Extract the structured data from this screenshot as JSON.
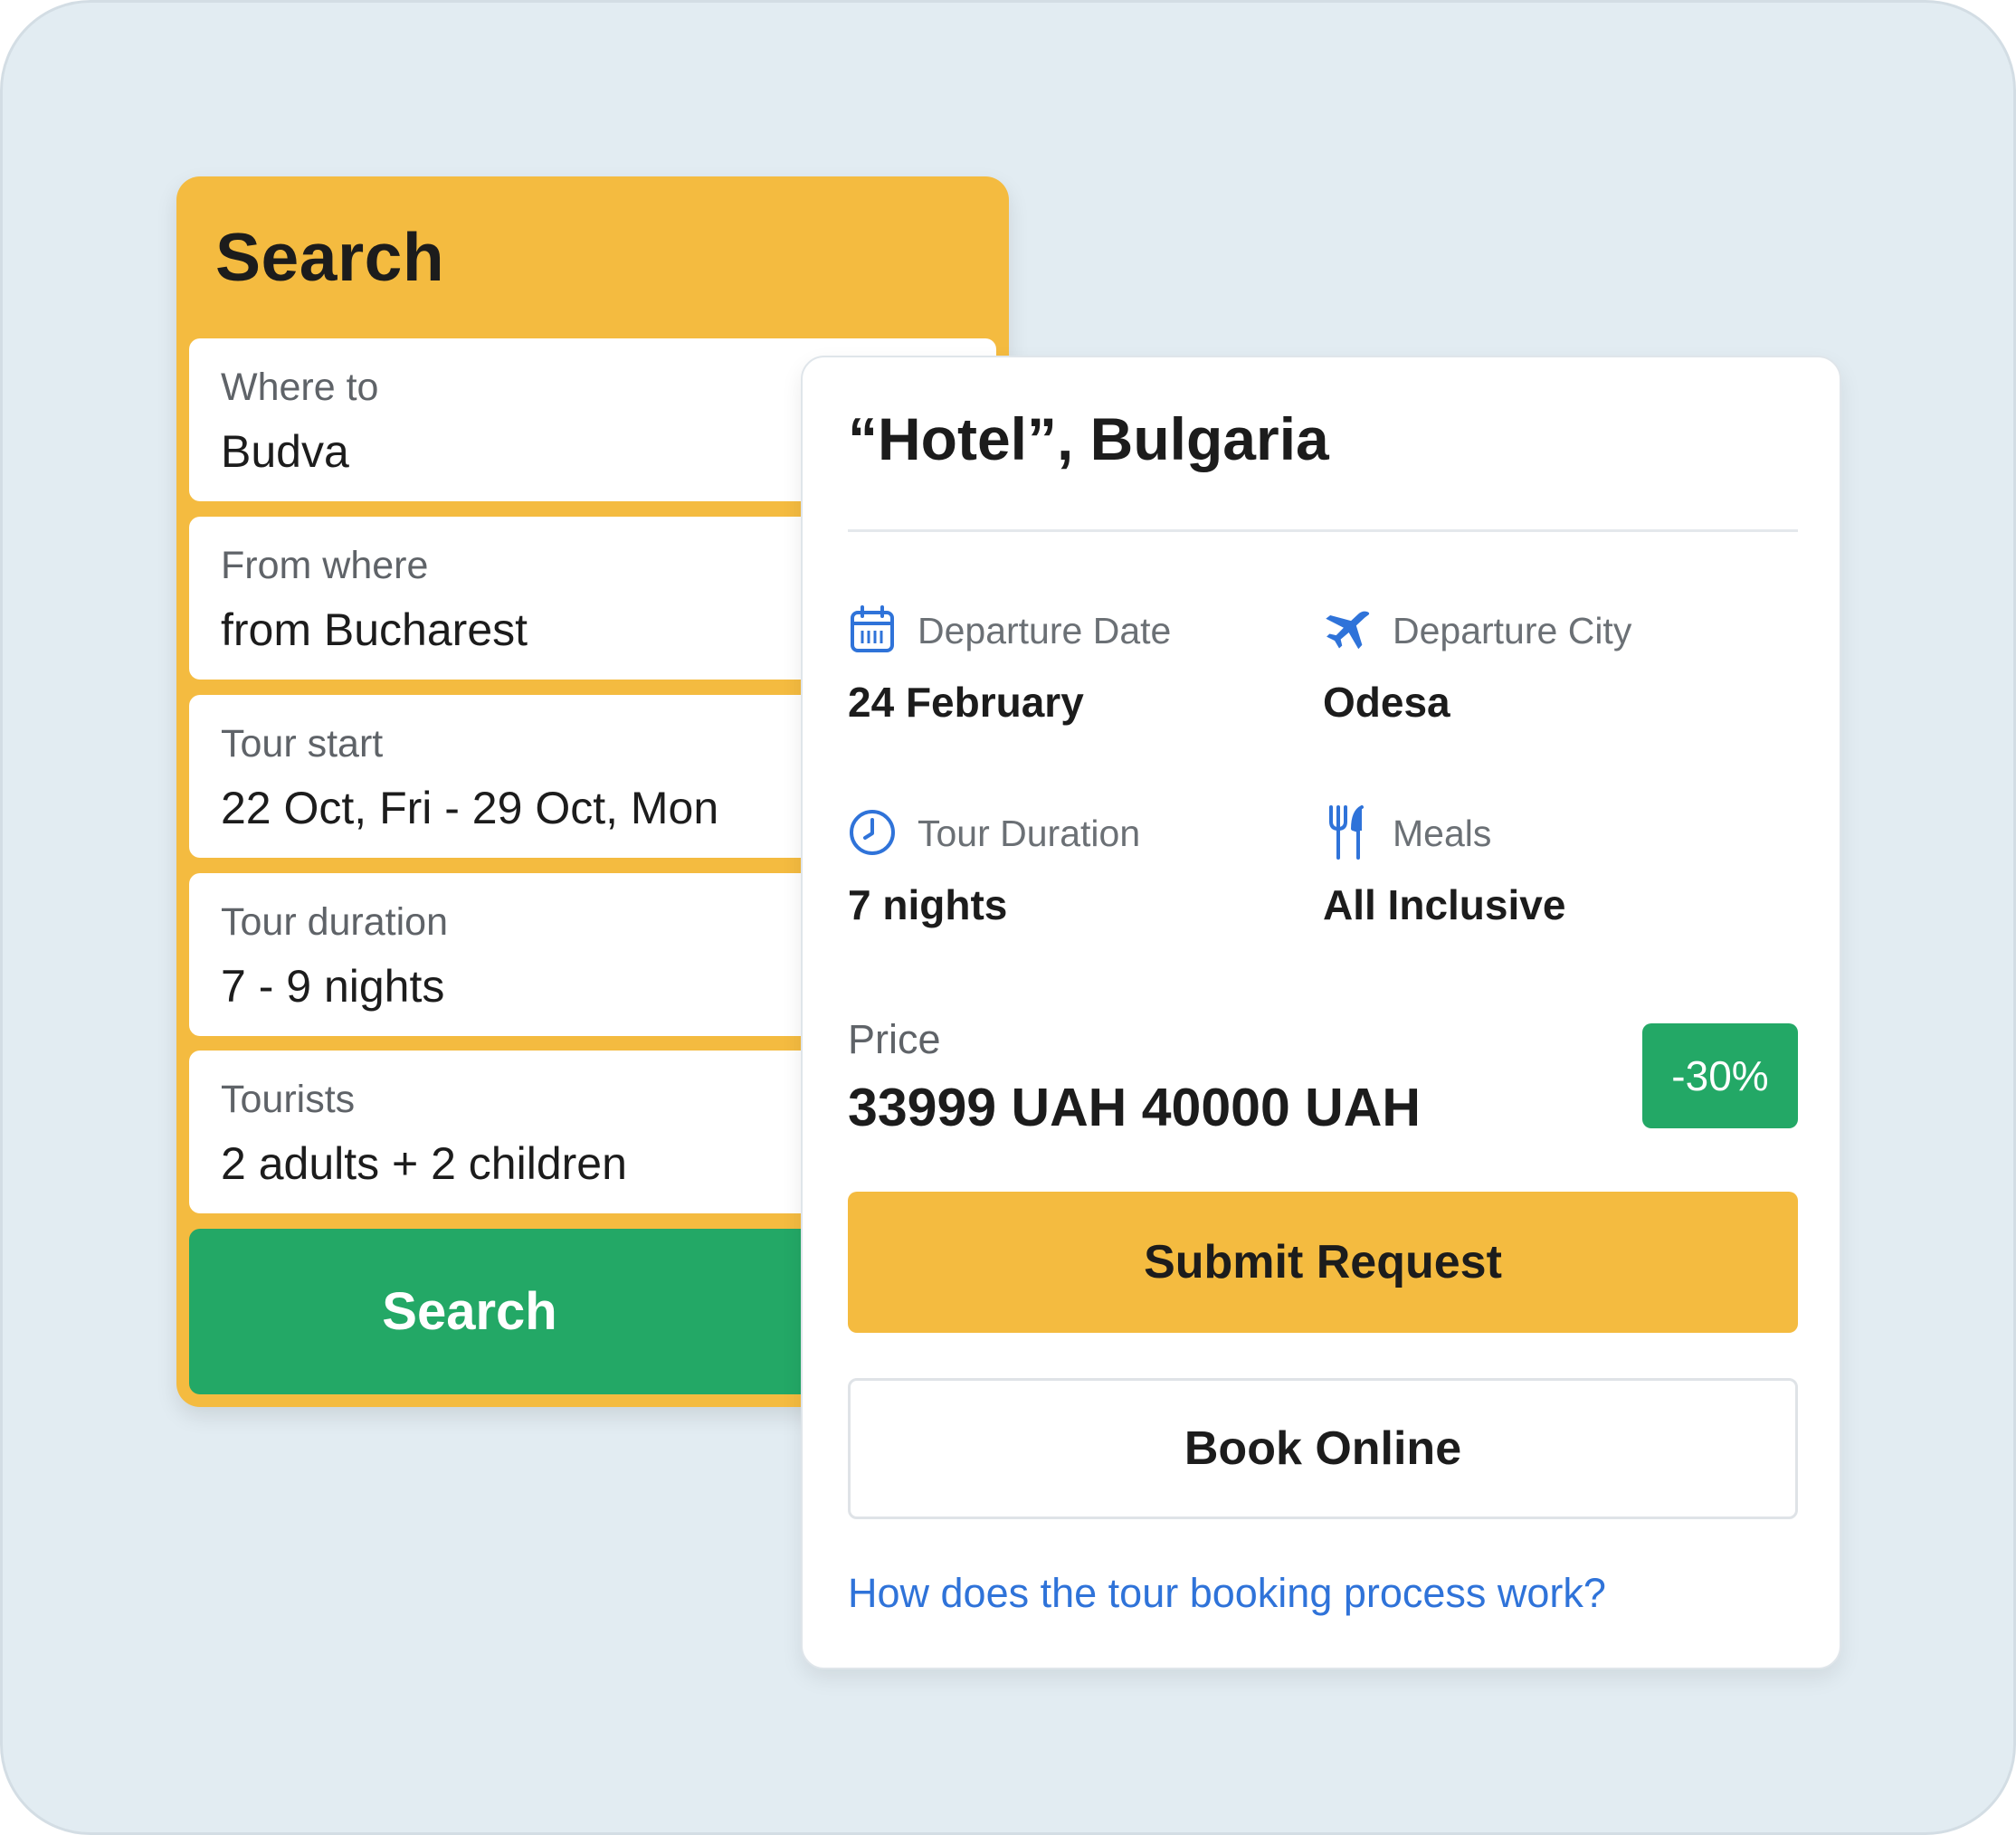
{
  "search": {
    "title": "Search",
    "fields": [
      {
        "label": "Where to",
        "value": "Budva"
      },
      {
        "label": "From where",
        "value": "from Bucharest"
      },
      {
        "label": "Tour start",
        "value": "22 Oct, Fri - 29 Oct, Mon"
      },
      {
        "label": "Tour duration",
        "value": "7 - 9 nights"
      },
      {
        "label": "Tourists",
        "value": "2 adults + 2 children"
      }
    ],
    "button_label": "Search"
  },
  "tour": {
    "title": "“Hotel”, Bulgaria",
    "info": [
      {
        "icon": "calendar-icon",
        "label": "Departure Date",
        "value": "24 February"
      },
      {
        "icon": "airplane-icon",
        "label": "Departure City",
        "value": "Odesa"
      },
      {
        "icon": "clock-icon",
        "label": "Tour Duration",
        "value": "7 nights"
      },
      {
        "icon": "utensils-icon",
        "label": "Meals",
        "value": "All Inclusive"
      }
    ],
    "price_label": "Price",
    "price_current": "33999 UAH",
    "price_old": "40000 UAH",
    "discount": "-30%",
    "submit_label": "Submit Request",
    "book_label": "Book Online",
    "help_link": "How does the tour booking process work?"
  },
  "colors": {
    "background": "#e2ecf2",
    "accent_yellow": "#f4bb40",
    "accent_green": "#23a866",
    "icon_blue": "#2f73d9",
    "link_blue": "#2f73d9"
  }
}
